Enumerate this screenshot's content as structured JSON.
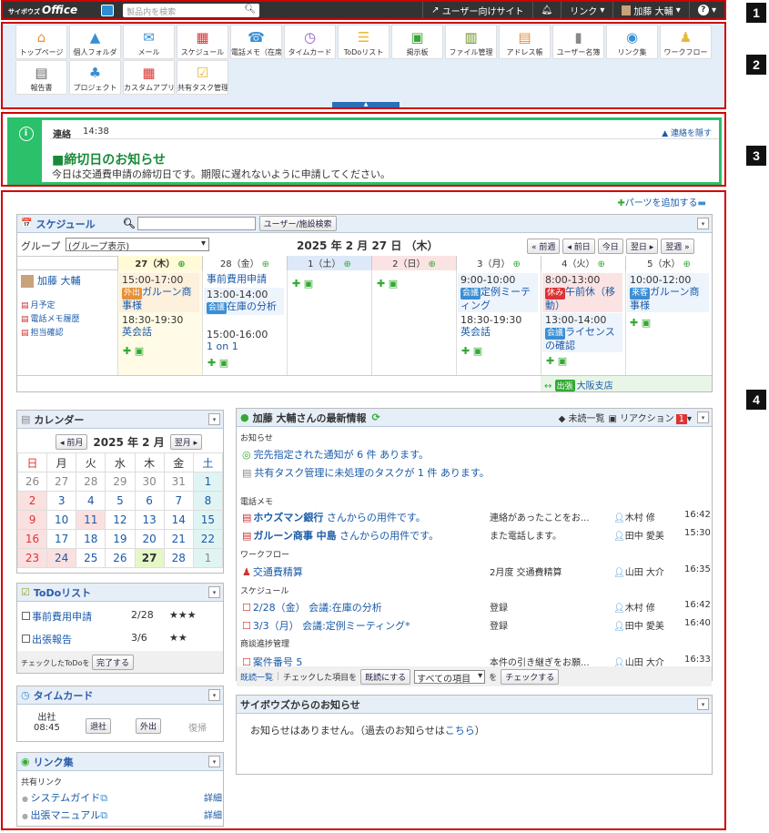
{
  "topbar": {
    "logo_small": "サイボウズ",
    "logo": "Office",
    "search_placeholder": "製品内を検索",
    "user_site": "ユーザー向けサイト",
    "link": "リンク",
    "user": "加藤 大輔",
    "help": "?"
  },
  "callouts": [
    "1",
    "2",
    "3",
    "4"
  ],
  "apps": [
    "トップページ",
    "個人フォルダ",
    "メール",
    "スケジュール",
    "電話メモ（在席",
    "タイムカード",
    "ToDoリスト",
    "掲示板",
    "ファイル管理",
    "アドレス帳",
    "ユーザー名簿",
    "リンク集",
    "ワークフロー",
    "報告書",
    "プロジェクト",
    "カスタムアプリ",
    "共有タスク管理"
  ],
  "notice": {
    "type": "連絡",
    "time": "14:38",
    "hide": "連絡を隠す",
    "title": "■締切日のお知らせ",
    "body": "今日は交通費申請の締切日です。期限に遅れないように申請してください。"
  },
  "add_parts": "パーツを追加する",
  "schedule": {
    "title": "スケジュール",
    "search_btn": "ユーザー/施設検索",
    "group_label": "グループ",
    "group_value": "(グループ表示)",
    "date": "2025 年 2 月 27 日 （木）",
    "nav": [
      "前週",
      "前日",
      "今日",
      "翌日",
      "翌週"
    ],
    "days": [
      "27（木）",
      "28（金）",
      "1（土）",
      "2（日）",
      "3（月）",
      "4（火）",
      "5（水）"
    ],
    "user": "加藤 大輔",
    "user_links": [
      "月予定",
      "電話メモ履歴",
      "担当確認"
    ],
    "d0": [
      "15:00-17:00",
      "外出",
      "ガルーン商事様",
      "18:30-19:30",
      "英会話"
    ],
    "d1": [
      "事前費用申請",
      "13:00-14:00",
      "会議",
      "在庫の分析",
      "15:00-16:00",
      "1 on 1"
    ],
    "d4": [
      "9:00-10:00",
      "会議",
      "定例ミーティング",
      "18:30-19:30",
      "英会話"
    ],
    "d5": [
      "8:00-13:00",
      "休み",
      "午前休（移動）",
      "13:00-14:00",
      "会議",
      "ライセンスの確認"
    ],
    "d6": [
      "10:00-12:00",
      "来客",
      "ガルーン商事様"
    ],
    "banner_tag": "出張",
    "banner": "大阪支店"
  },
  "calendar": {
    "title": "カレンダー",
    "prev": "前月",
    "next": "翌月",
    "month": "2025 年 2 月",
    "weekdays": [
      "日",
      "月",
      "火",
      "水",
      "木",
      "金",
      "土"
    ],
    "weeks": [
      [
        "26",
        "27",
        "28",
        "29",
        "30",
        "31",
        "1"
      ],
      [
        "2",
        "3",
        "4",
        "5",
        "6",
        "7",
        "8"
      ],
      [
        "9",
        "10",
        "11",
        "12",
        "13",
        "14",
        "15"
      ],
      [
        "16",
        "17",
        "18",
        "19",
        "20",
        "21",
        "22"
      ],
      [
        "23",
        "24",
        "25",
        "26",
        "27",
        "28",
        "1"
      ]
    ]
  },
  "todo": {
    "title": "ToDoリスト",
    "items": [
      {
        "name": "事前費用申請",
        "date": "2/28",
        "stars": "★★★"
      },
      {
        "name": "出張報告",
        "date": "3/6",
        "stars": "★★"
      }
    ],
    "footer": "チェックしたToDoを",
    "done": "完了する"
  },
  "timecard": {
    "title": "タイムカード",
    "in_label": "出社",
    "in_time": "08:45",
    "out": "退社",
    "go": "外出",
    "back": "復帰"
  },
  "links": {
    "title": "リンク集",
    "section": "共有リンク",
    "items": [
      {
        "name": "システムガイド",
        "detail": "詳細"
      },
      {
        "name": "出張マニュアル",
        "detail": "詳細"
      }
    ]
  },
  "latest": {
    "title": "加藤 大輔さんの最新情報",
    "unread": "未読一覧",
    "reaction": "リアクション",
    "reaction_count": "1",
    "sec_notice": "お知らせ",
    "n1": "完先指定された通知が 6 件 あります。",
    "n2": "共有タスク管理に未処理のタスクが 1 件 あります。",
    "sec_memo": "電話メモ",
    "memo": [
      {
        "from": "ホウズマン銀行",
        "text": " さんからの用件です。",
        "desc": "連絡があったことをお...",
        "user": "木村 修",
        "time": "16:42"
      },
      {
        "from": "ガルーン商事 中島",
        "text": " さんからの用件です。",
        "desc": "また電話します。",
        "user": "田中 愛美",
        "time": "15:30"
      }
    ],
    "sec_wf": "ワークフロー",
    "wf": {
      "name": "交通費精算",
      "desc": "2月度 交通費精算",
      "user": "山田 大介",
      "time": "16:35"
    },
    "sec_sch": "スケジュール",
    "sch": [
      {
        "name": "2/28（金） 会議:在庫の分析",
        "desc": "登録",
        "user": "木村 修",
        "time": "16:42"
      },
      {
        "name": "3/3（月） 会議:定例ミーティング*",
        "desc": "登録",
        "user": "田中 愛美",
        "time": "16:40"
      }
    ],
    "sec_deal": "商談進捗管理",
    "deal": {
      "name": "案件番号 5",
      "desc": "本件の引き継ぎをお願...",
      "user": "山田 大介",
      "time": "16:33"
    },
    "footer_read": "既読一覧",
    "footer_checked": "チェックした項目を",
    "mark_read": "既読にする",
    "select": "すべての項目",
    "wo": "を",
    "check": "チェックする"
  },
  "cybozu": {
    "title": "サイボウズからのお知らせ",
    "text": "お知らせはありません。（過去のお知らせは",
    "link": "こちら",
    "close": "）"
  }
}
